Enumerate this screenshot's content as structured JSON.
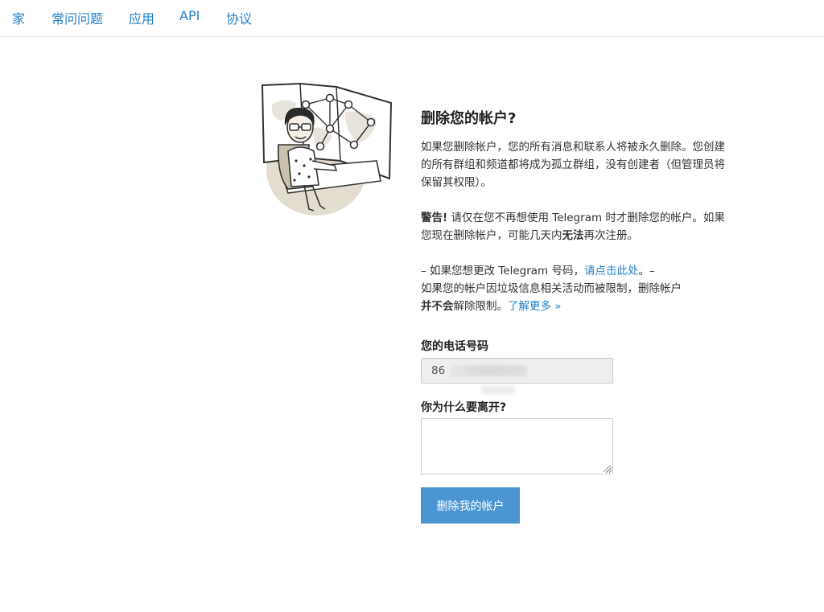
{
  "nav": {
    "items": [
      {
        "label": "家"
      },
      {
        "label": "常问问题"
      },
      {
        "label": "应用"
      },
      {
        "label": "API"
      },
      {
        "label": "协议"
      }
    ]
  },
  "main": {
    "title": "删除您的帐户?",
    "intro": "如果您删除帐户，您的所有消息和联系人将被永久删除。您创建的所有群组和频道都将成为孤立群组，没有创建者（但管理员将保留其权限）。",
    "warning_strong": "警告!",
    "warning_text_1": " 请仅在您不再想使用 Telegram 时才删除您的帐户。如果您现在删除帐户，可能几天内",
    "warning_strong_2": "无法",
    "warning_text_2": "再次注册。",
    "change_prefix": "– 如果您想更改 Telegram 号码，",
    "change_link": "请点击此处",
    "change_suffix": "。–",
    "spam_text_1": "如果您的帐户因垃圾信息相关活动而被限制，删除帐户",
    "spam_strong": "并不会",
    "spam_text_2": "解除限制。",
    "learn_more_link": "了解更多 »"
  },
  "form": {
    "phone_label": "您的电话号码",
    "phone_value": "86",
    "reason_label": "你为什么要离开?",
    "reason_value": "",
    "delete_button": "删除我的帐户"
  },
  "colors": {
    "link": "#2481cc",
    "button": "#4a95d2"
  }
}
